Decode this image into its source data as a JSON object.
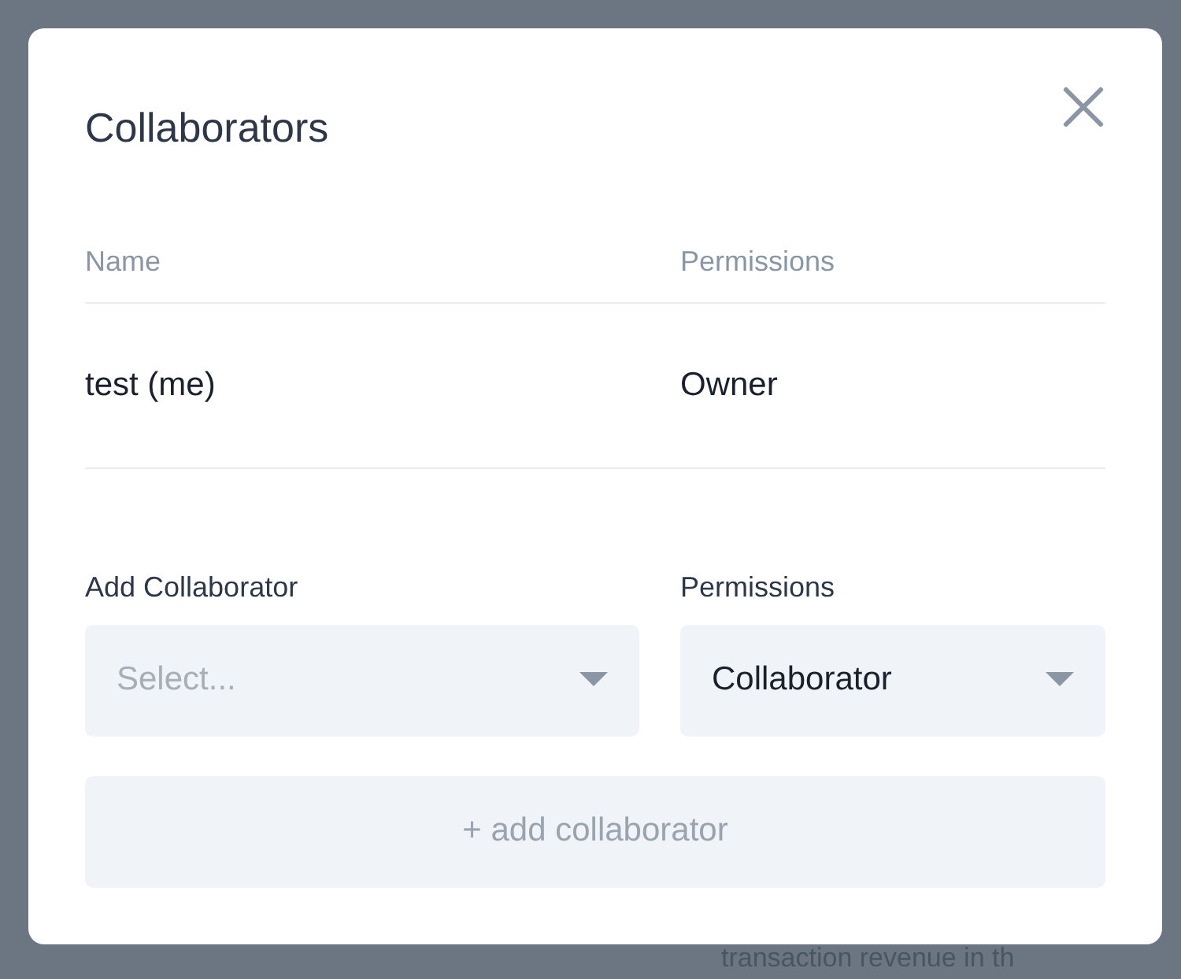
{
  "background": {
    "text": "transaction revenue in th"
  },
  "modal": {
    "title": "Collaborators",
    "table": {
      "columns": [
        "Name",
        "Permissions"
      ],
      "rows": [
        {
          "name": "test (me)",
          "permissions": "Owner"
        }
      ]
    },
    "add_form": {
      "collaborator": {
        "label": "Add Collaborator",
        "placeholder": "Select..."
      },
      "permissions": {
        "label": "Permissions",
        "value": "Collaborator"
      },
      "button": "+ add collaborator"
    }
  }
}
